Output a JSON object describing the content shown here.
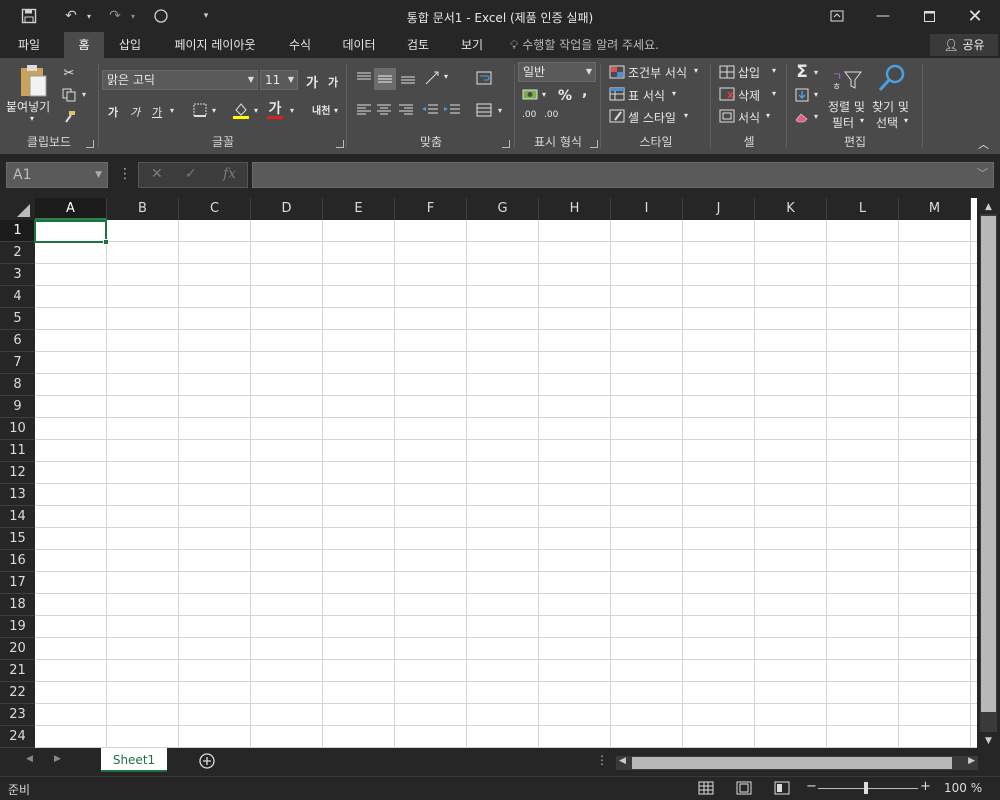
{
  "title": "통합 문서1 - Excel (제품 인증 실패)",
  "tabs": [
    "파일",
    "홈",
    "삽입",
    "페이지 레이아웃",
    "수식",
    "데이터",
    "검토",
    "보기"
  ],
  "tell_me": "수행할 작업을 알려 주세요.",
  "share": "공유",
  "clipboard": {
    "paste": "붙여넣기",
    "label": "클립보드"
  },
  "font": {
    "name": "맑은 고딕",
    "size": "11",
    "label": "글꼴",
    "grow": "가",
    "shrink": "가",
    "bold": "가",
    "italic": "가",
    "underline": "가",
    "color": "가",
    "phonetic": "내천"
  },
  "alignment": {
    "label": "맞춤"
  },
  "number": {
    "format": "일반",
    "label": "표시 형식",
    "percent": "%",
    "comma": ",",
    "inc": ".00",
    "dec": ".00"
  },
  "styles": {
    "conditional": "조건부 서식",
    "table": "표 서식",
    "cell": "셀 스타일",
    "label": "스타일"
  },
  "cells": {
    "insert": "삽입",
    "delete": "삭제",
    "format": "서식",
    "label": "셀"
  },
  "editing": {
    "sort": "정렬 및",
    "sort2": "필터",
    "find": "찾기 및",
    "find2": "선택",
    "label": "편집"
  },
  "namebox": "A1",
  "fx": "fx",
  "columns": [
    "A",
    "B",
    "C",
    "D",
    "E",
    "F",
    "G",
    "H",
    "I",
    "J",
    "K",
    "L",
    "M"
  ],
  "rows": [
    "1",
    "2",
    "3",
    "4",
    "5",
    "6",
    "7",
    "8",
    "9",
    "10",
    "11",
    "12",
    "13",
    "14",
    "15",
    "16",
    "17",
    "18",
    "19",
    "20",
    "21",
    "22",
    "23",
    "24"
  ],
  "sheet_tab": "Sheet1",
  "status": "준비",
  "zoom": "100 %",
  "accent": "#1e7145"
}
